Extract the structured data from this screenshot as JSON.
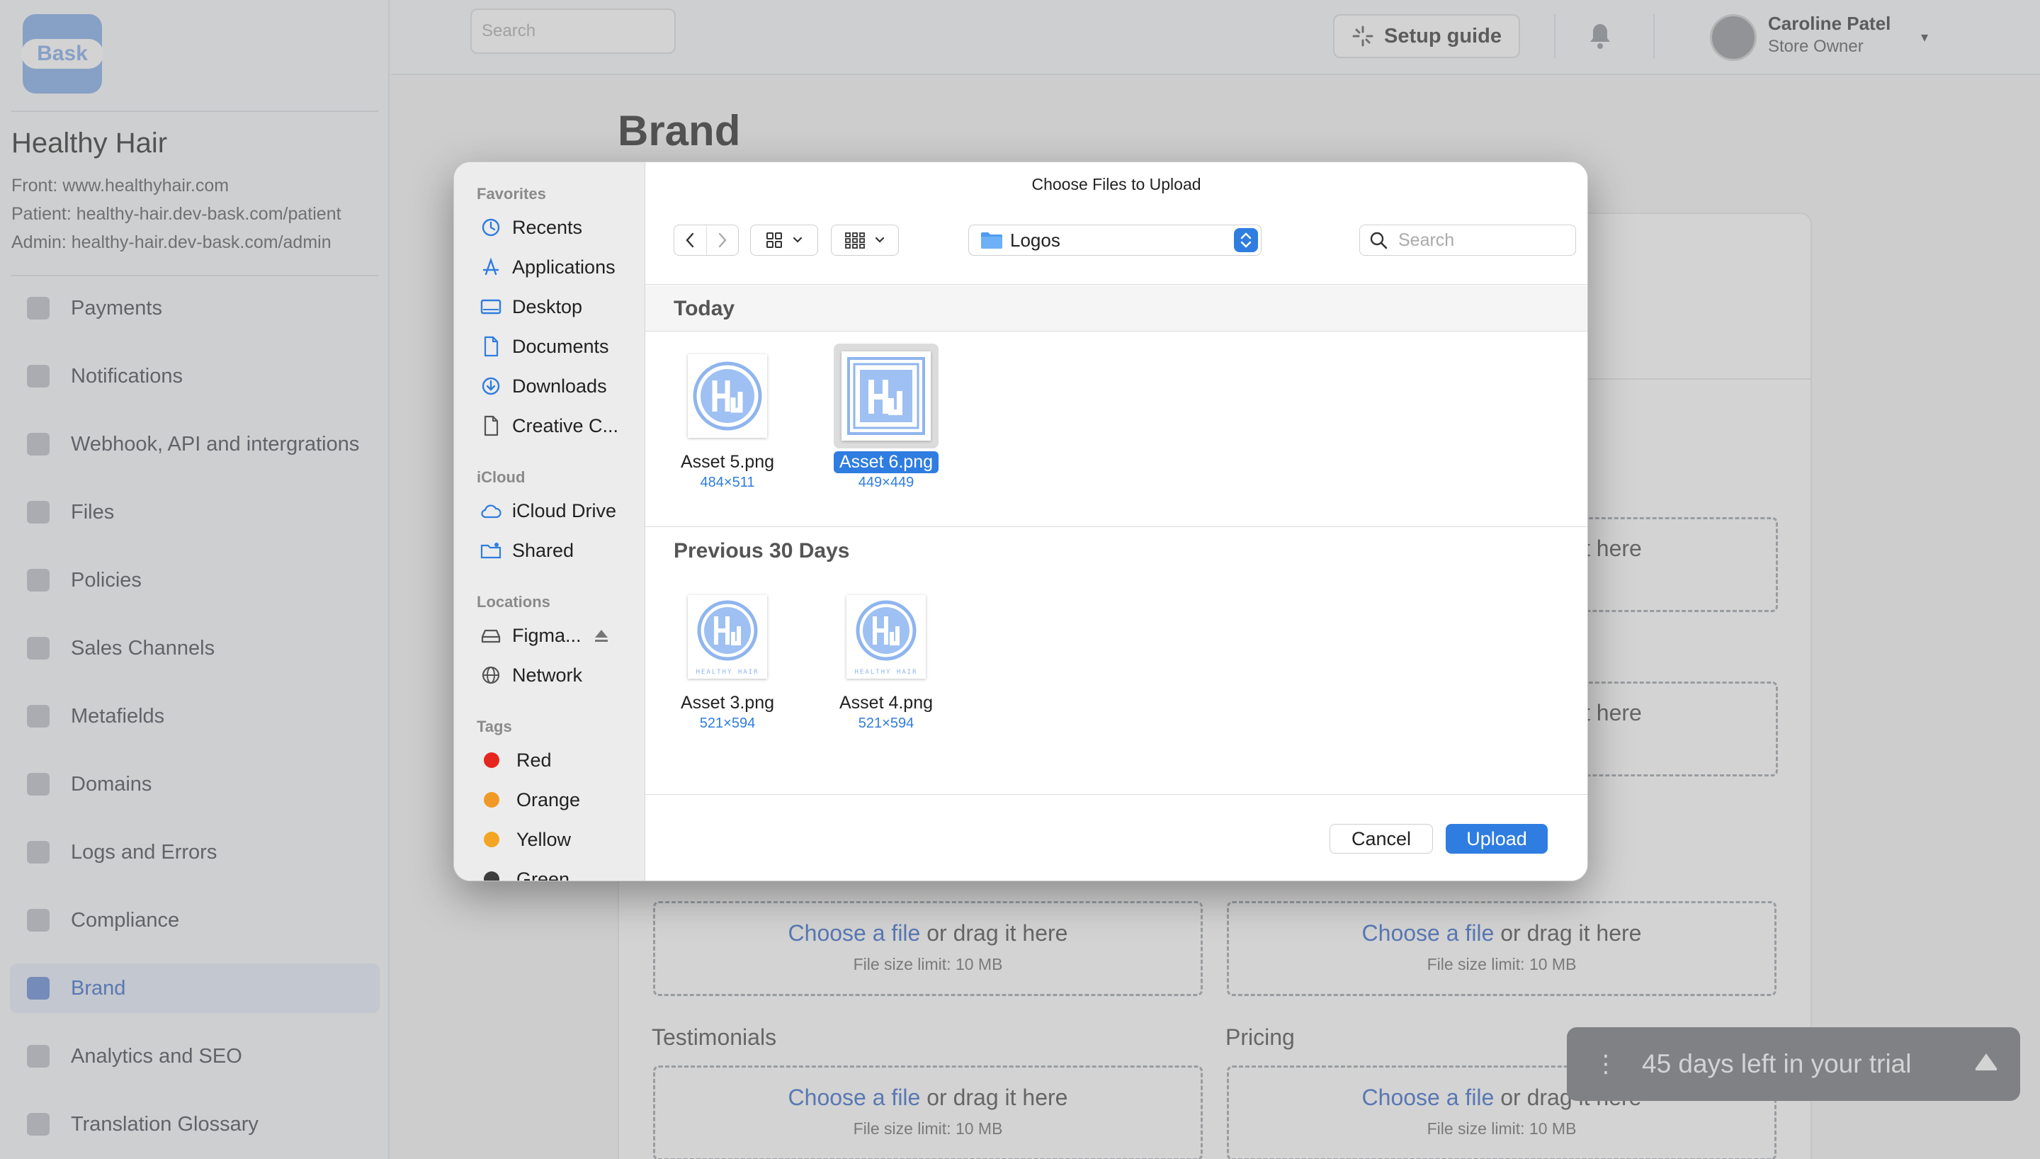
{
  "app": {
    "logo_text": "Bask",
    "store": {
      "name": "Healthy Hair",
      "front": "Front: www.healthyhair.com",
      "patient": "Patient: healthy-hair.dev-bask.com/patient",
      "admin": "Admin: healthy-hair.dev-bask.com/admin"
    },
    "nav": [
      {
        "label": "Payments",
        "icon": "payments-icon"
      },
      {
        "label": "Notifications",
        "icon": "bell-icon"
      },
      {
        "label": "Webhook, API and intergrations",
        "icon": "webhook-icon"
      },
      {
        "label": "Files",
        "icon": "file-icon"
      },
      {
        "label": "Policies",
        "icon": "policy-icon"
      },
      {
        "label": "Sales Channels",
        "icon": "channels-icon"
      },
      {
        "label": "Metafields",
        "icon": "metafields-icon"
      },
      {
        "label": "Domains",
        "icon": "globe-icon"
      },
      {
        "label": "Logs and Errors",
        "icon": "tools-icon"
      },
      {
        "label": "Compliance",
        "icon": "compliance-icon"
      },
      {
        "label": "Brand",
        "icon": "brand-icon",
        "active": true
      },
      {
        "label": "Analytics and SEO",
        "icon": "analytics-icon"
      },
      {
        "label": "Translation Glossary",
        "icon": "translate-icon"
      }
    ],
    "topbar": {
      "search_placeholder": "Search",
      "setup_guide": "Setup guide",
      "user_name": "Caroline Patel",
      "user_role": "Store Owner"
    },
    "page_title": "Brand",
    "drop_zone": {
      "link": "Choose a file",
      "rest": " or drag it here",
      "limit": "File size limit: 10 MB",
      "partial": "t here"
    },
    "sections": {
      "testimonials": "Testimonials",
      "pricing": "Pricing"
    },
    "trial": {
      "dots": "⋮",
      "text": "45 days left in your trial"
    },
    "colors": {
      "accent": "#2d62c9",
      "dialog_accent": "#2f7de0"
    }
  },
  "dialog": {
    "title": "Choose Files to Upload",
    "location": "Logos",
    "search_placeholder": "Search",
    "sidebar": {
      "favorites_label": "Favorites",
      "favorites": [
        {
          "label": "Recents",
          "icon": "clock-icon"
        },
        {
          "label": "Applications",
          "icon": "applications-icon"
        },
        {
          "label": "Desktop",
          "icon": "desktop-icon"
        },
        {
          "label": "Documents",
          "icon": "document-icon"
        },
        {
          "label": "Downloads",
          "icon": "download-icon"
        },
        {
          "label": "Creative C...",
          "icon": "file-icon"
        }
      ],
      "icloud_label": "iCloud",
      "icloud": [
        {
          "label": "iCloud Drive",
          "icon": "cloud-icon"
        },
        {
          "label": "Shared",
          "icon": "shared-folder-icon"
        }
      ],
      "locations_label": "Locations",
      "locations": [
        {
          "label": "Figma...",
          "icon": "drive-icon"
        },
        {
          "label": "Network",
          "icon": "globe-icon"
        }
      ],
      "tags_label": "Tags",
      "tags": [
        {
          "label": "Red",
          "color": "#e5261f"
        },
        {
          "label": "Orange",
          "color": "#f09a25"
        },
        {
          "label": "Yellow",
          "color": "#f4a523"
        },
        {
          "label": "Green",
          "color": "#3d3d3d"
        }
      ]
    },
    "groups": {
      "today": "Today",
      "previous": "Previous 30 Days"
    },
    "files_today": [
      {
        "name": "Asset 5.png",
        "dims": "484×511"
      },
      {
        "name": "Asset 6.png",
        "dims": "449×449",
        "selected": true
      }
    ],
    "files_previous": [
      {
        "name": "Asset 3.png",
        "dims": "521×594",
        "caption": "HEALTHY HAIR"
      },
      {
        "name": "Asset 4.png",
        "dims": "521×594",
        "caption": "HEALTHY HAIR"
      }
    ],
    "buttons": {
      "cancel": "Cancel",
      "upload": "Upload"
    }
  }
}
